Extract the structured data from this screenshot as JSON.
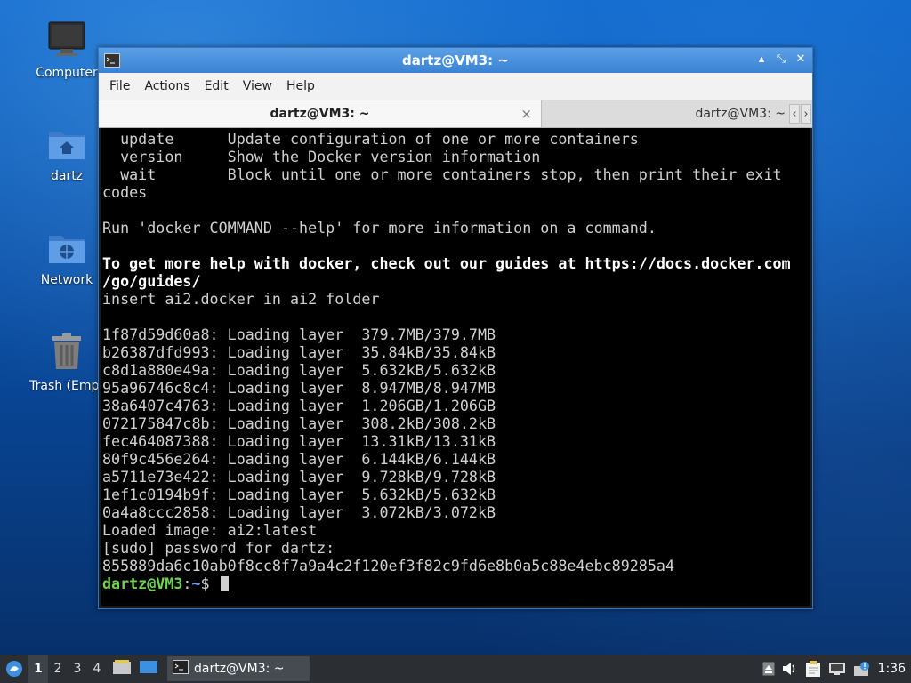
{
  "desktop": {
    "icons": [
      {
        "label": "Computer"
      },
      {
        "label": "dartz"
      },
      {
        "label": "Network"
      },
      {
        "label": "Trash (Empt"
      }
    ]
  },
  "window": {
    "title": "dartz@VM3: ~",
    "menu": [
      "File",
      "Actions",
      "Edit",
      "View",
      "Help"
    ],
    "tabs": [
      {
        "label": "dartz@VM3: ~",
        "close": "×"
      },
      {
        "label": "dartz@VM3: ~"
      }
    ],
    "controls": {
      "minimize": "▴",
      "maximize": "⤡",
      "close": "✕"
    }
  },
  "terminal": {
    "lines": [
      "  update      Update configuration of one or more containers",
      "  version     Show the Docker version information",
      "  wait        Block until one or more containers stop, then print their exit",
      "codes",
      "",
      "Run 'docker COMMAND --help' for more information on a command.",
      "",
      "To get more help with docker, check out our guides at https://docs.docker.com",
      "/go/guides/",
      "insert ai2.docker in ai2 folder",
      "",
      "1f87d59d60a8: Loading layer  379.7MB/379.7MB",
      "b26387dfd993: Loading layer  35.84kB/35.84kB",
      "c8d1a880e49a: Loading layer  5.632kB/5.632kB",
      "95a96746c8c4: Loading layer  8.947MB/8.947MB",
      "38a6407c4763: Loading layer  1.206GB/1.206GB",
      "072175847c8b: Loading layer  308.2kB/308.2kB",
      "fec464087388: Loading layer  13.31kB/13.31kB",
      "80f9c456e264: Loading layer  6.144kB/6.144kB",
      "a5711e73e422: Loading layer  9.728kB/9.728kB",
      "1ef1c0194b9f: Loading layer  5.632kB/5.632kB",
      "0a4a8ccc2858: Loading layer  3.072kB/3.072kB",
      "Loaded image: ai2:latest",
      "[sudo] password for dartz:",
      "855889da6c10ab0f8cc8f7a9a4c2f120ef3f82c9fd6e8b0a5c88e4ebc89285a4"
    ],
    "bold_lines": [
      7,
      8
    ],
    "prompt": {
      "user": "dartz@VM3",
      "sep": ":",
      "path": "~",
      "symbol": "$ "
    }
  },
  "taskbar": {
    "workspaces": [
      "1",
      "2",
      "3",
      "4"
    ],
    "active_workspace": "1",
    "task": {
      "label": "dartz@VM3: ~"
    },
    "clock": "1:36"
  },
  "colors": {
    "prompt_user": "#6fd34f",
    "prompt_path": "#6f9eff",
    "titlebar": "#3b82d3"
  }
}
